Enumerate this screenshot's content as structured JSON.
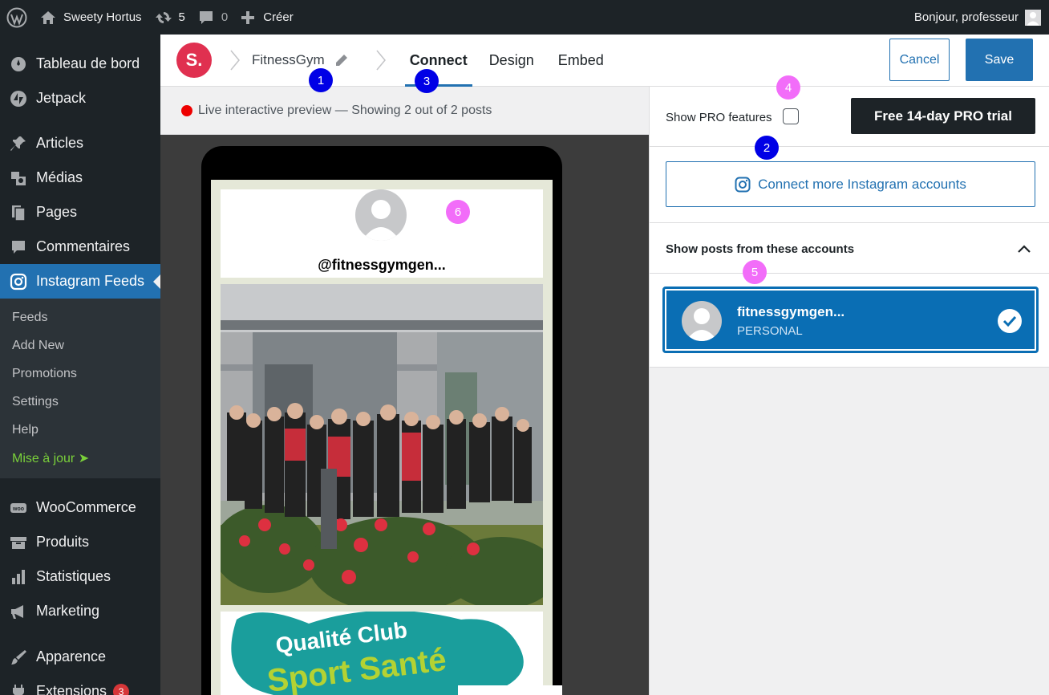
{
  "admin_bar": {
    "site_name": "Sweety Hortus",
    "updates_count": "5",
    "comments_count": "0",
    "create_label": "Créer",
    "greeting": "Bonjour, professeur"
  },
  "sidebar": {
    "items": [
      {
        "label": "Tableau de bord",
        "icon": "dashboard-icon"
      },
      {
        "label": "Jetpack",
        "icon": "jetpack-icon"
      },
      {
        "label": "Articles",
        "icon": "pin-icon"
      },
      {
        "label": "Médias",
        "icon": "media-icon"
      },
      {
        "label": "Pages",
        "icon": "pages-icon"
      },
      {
        "label": "Commentaires",
        "icon": "comment-icon"
      },
      {
        "label": "Instagram Feeds",
        "icon": "instagram-icon",
        "active": true
      }
    ],
    "submenu": [
      "Feeds",
      "Add New",
      "Promotions",
      "Settings",
      "Help",
      "Mise à jour ➤"
    ],
    "items_after": [
      {
        "label": "WooCommerce",
        "icon": "woocommerce-icon"
      },
      {
        "label": "Produits",
        "icon": "products-icon"
      },
      {
        "label": "Statistiques",
        "icon": "stats-icon"
      },
      {
        "label": "Marketing",
        "icon": "megaphone-icon"
      },
      {
        "label": "Apparence",
        "icon": "brush-icon"
      },
      {
        "label": "Extensions",
        "icon": "plugin-icon",
        "badge": "3"
      }
    ]
  },
  "topbar": {
    "logo_text": "S.",
    "feed_name": "FitnessGym",
    "tabs": [
      "Connect",
      "Design",
      "Embed"
    ],
    "active_tab": "Connect",
    "cancel_label": "Cancel",
    "save_label": "Save"
  },
  "preview": {
    "status_text": "Live interactive preview — Showing 2 out of 2 posts",
    "username": "@fitnessgymgen...",
    "post2_text_line1": "Qualité Club",
    "post2_text_line2": "Sport Santé"
  },
  "panel": {
    "show_pro_label": "Show PRO features",
    "show_pro_checked": false,
    "trial_button": "Free 14-day PRO trial",
    "connect_button": "Connect more Instagram accounts",
    "accounts_header": "Show posts from these accounts",
    "account": {
      "name": "fitnessgymgen...",
      "type": "PERSONAL",
      "selected": true
    }
  },
  "markers": [
    "1",
    "2",
    "3",
    "4",
    "5",
    "6"
  ],
  "colors": {
    "wp_dark": "#1d2327",
    "wp_blue": "#2271b1",
    "logo_red": "#e03050",
    "account_blue": "#0a6eb4",
    "marker_blue": "#0000e6",
    "marker_pink": "#f26df9"
  }
}
